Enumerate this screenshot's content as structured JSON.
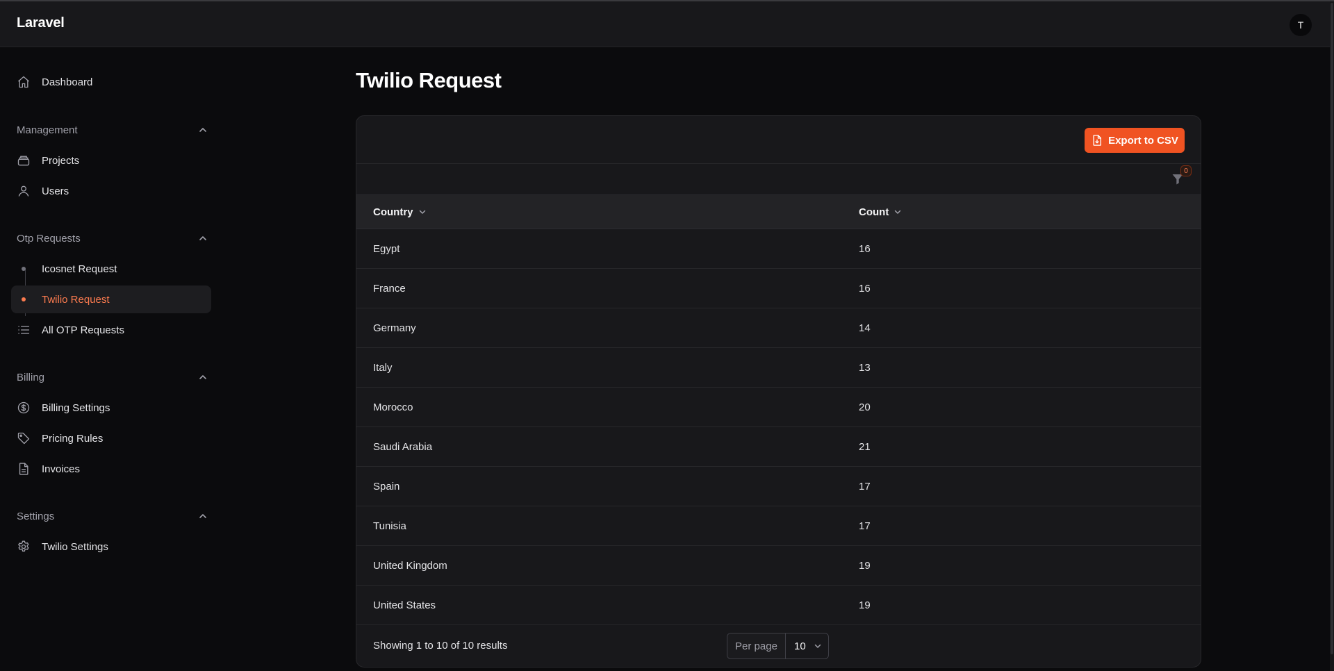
{
  "app": {
    "brand": "Laravel",
    "user_initial": "T"
  },
  "sidebar": {
    "dashboard": "Dashboard",
    "groups": {
      "management": {
        "label": "Management",
        "items": [
          "Projects",
          "Users"
        ]
      },
      "otp": {
        "label": "Otp Requests",
        "items": [
          "Icosnet Request",
          "Twilio Request",
          "All OTP Requests"
        ]
      },
      "billing": {
        "label": "Billing",
        "items": [
          "Billing Settings",
          "Pricing Rules",
          "Invoices"
        ]
      },
      "settings": {
        "label": "Settings",
        "items": [
          "Twilio Settings"
        ]
      }
    },
    "active_item": "Twilio Request"
  },
  "page": {
    "title": "Twilio Request"
  },
  "toolbar": {
    "export_label": "Export to CSV",
    "filter_count": "0"
  },
  "table": {
    "columns": [
      "Country",
      "Count"
    ],
    "rows": [
      [
        "Egypt",
        "16"
      ],
      [
        "France",
        "16"
      ],
      [
        "Germany",
        "14"
      ],
      [
        "Italy",
        "13"
      ],
      [
        "Morocco",
        "20"
      ],
      [
        "Saudi Arabia",
        "21"
      ],
      [
        "Spain",
        "17"
      ],
      [
        "Tunisia",
        "17"
      ],
      [
        "United Kingdom",
        "19"
      ],
      [
        "United States",
        "19"
      ]
    ]
  },
  "pagination": {
    "summary": "Showing 1 to 10 of 10 results",
    "per_page_label": "Per page",
    "per_page_value": "10"
  },
  "colors": {
    "accent": "#f05322",
    "active_text": "#fb7b4f",
    "background": "#0b0b0d",
    "card": "#18181b"
  },
  "icons": {
    "dashboard": "home-icon",
    "projects": "stack-icon",
    "users": "user-icon",
    "all_otp": "list-icon",
    "billing_settings": "dollar-circle-icon",
    "pricing_rules": "tag-icon",
    "invoices": "document-icon",
    "twilio_settings": "gear-icon",
    "export": "document-download-icon",
    "filter": "funnel-icon"
  }
}
